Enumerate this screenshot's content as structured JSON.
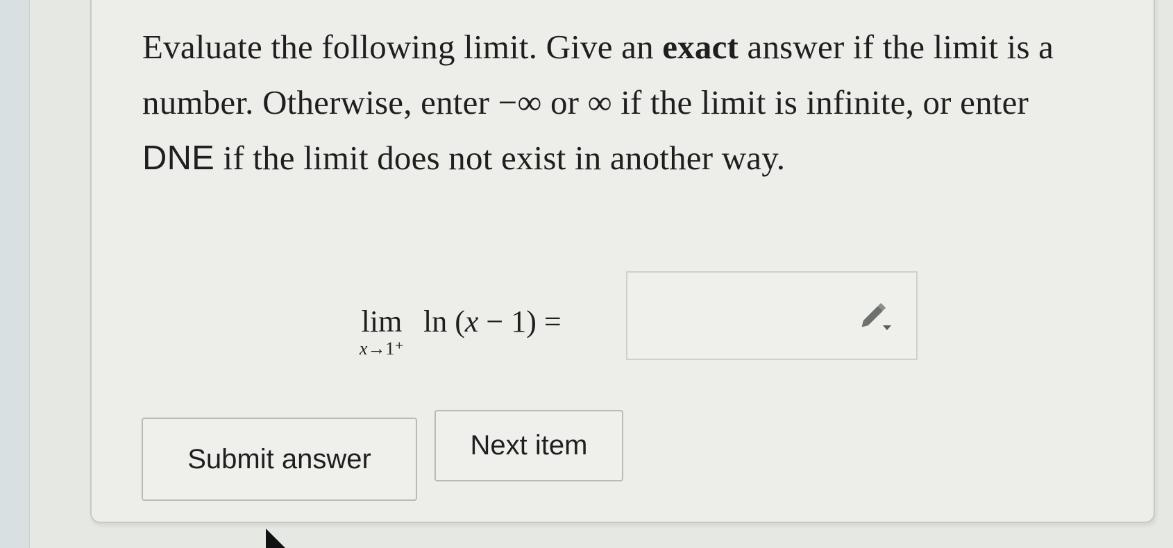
{
  "question": {
    "text_1": "Evaluate the following limit. Give an ",
    "bold_word": "exact",
    "text_2": " answer if the limit is a number. Otherwise, enter −∞ or ∞ if the limit is infinite, or enter ",
    "dne": "DNE",
    "text_3": " if the limit does not exist in another way."
  },
  "math": {
    "lim": "lim",
    "sub_var": "x",
    "sub_rest": "→1⁺",
    "expr_left": "ln (",
    "expr_var": "x",
    "expr_right": " − 1) ="
  },
  "answer": {
    "value": "",
    "icon": "pencil-dropdown-icon"
  },
  "buttons": {
    "submit": "Submit answer",
    "next": "Next item"
  },
  "colors": {
    "panel_background": "#ededea",
    "side_strip": "#d9e0e1",
    "border": "#c9cac6",
    "text": "#1f1f1f",
    "icon": "#5a5f5c"
  }
}
